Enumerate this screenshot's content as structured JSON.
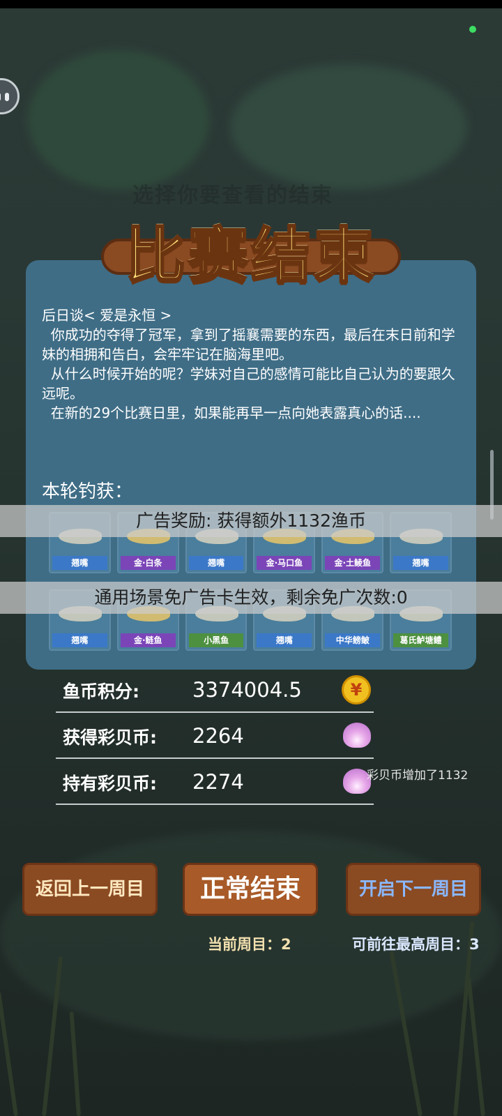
{
  "banner": {
    "title": "比赛结束"
  },
  "background": {
    "ghost_title": "选择你要查看的结束"
  },
  "story": {
    "lines": [
      "后日谈< 爱是永恒 >",
      "  你成功的夺得了冠军，拿到了摇襄需要的东西，最后在末日前和学妹的相拥和告白，会牢牢记在脑海里吧。",
      "  从什么时候开始的呢？学妹对自己的感情可能比自己认为的要跟久远呢。",
      "  在新的29个比赛日里，如果能再早一点向她表露真心的话...."
    ]
  },
  "catch": {
    "label": "本轮钓获：",
    "row1": [
      {
        "name": "翘嘴",
        "tier": "blue"
      },
      {
        "name": "金·白条",
        "tier": "purple"
      },
      {
        "name": "翘嘴",
        "tier": "blue"
      },
      {
        "name": "金·马口鱼",
        "tier": "purple"
      },
      {
        "name": "金·土鲮鱼",
        "tier": "purple"
      },
      {
        "name": "翘嘴",
        "tier": "blue"
      }
    ],
    "row2": [
      {
        "name": "翘嘴",
        "tier": "blue"
      },
      {
        "name": "金·鲢鱼",
        "tier": "purple"
      },
      {
        "name": "小黑鱼",
        "tier": "green"
      },
      {
        "name": "翘嘴",
        "tier": "blue"
      },
      {
        "name": "中华鳑鲏",
        "tier": "blue"
      },
      {
        "name": "葛氏鲈塘鳢",
        "tier": "green"
      }
    ]
  },
  "toasts": {
    "ad_reward": "广告奖励: 获得额外1132渔币",
    "ad_card": "通用场景免广告卡生效，剩余免广次数:0"
  },
  "stats": {
    "fish_points_label": "鱼币积分:",
    "fish_points_value": "3374004.5",
    "shell_gain_label": "获得彩贝币:",
    "shell_gain_value": "2264",
    "shell_hold_label": "持有彩贝币:",
    "shell_hold_value": "2274",
    "shell_note": "彩贝币增加了1132",
    "coin_glyph": "¥"
  },
  "buttons": {
    "prev_round": "返回上一周目",
    "normal_end": "正常结束",
    "next_round": "开启下一周目"
  },
  "rounds": {
    "current": "当前周目：2",
    "max": "可前往最高周目：3"
  }
}
